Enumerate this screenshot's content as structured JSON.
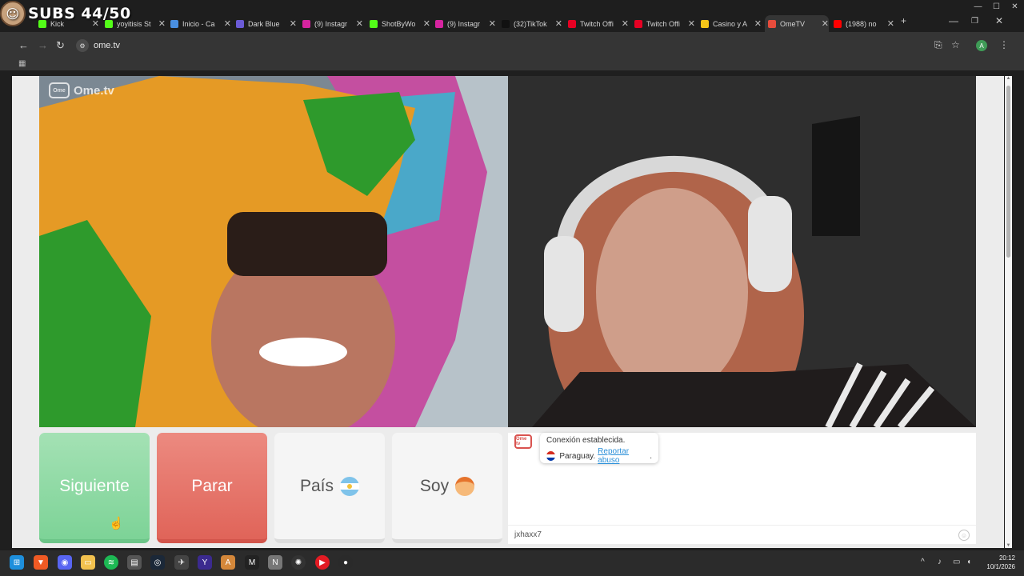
{
  "overlay": {
    "subs_text": "SUBS 44/50"
  },
  "browser": {
    "tabs": [
      {
        "title": "Kick",
        "icon": "kick-icon",
        "color": "#53fc18"
      },
      {
        "title": "yoyitisis St",
        "icon": "kick-icon",
        "color": "#53fc18"
      },
      {
        "title": "Inicio - Ca",
        "icon": "globe-icon",
        "color": "#4a90e2"
      },
      {
        "title": "Dark Blue",
        "icon": "bookmark-icon",
        "color": "#6b5bd6"
      },
      {
        "title": "(9) Instagr",
        "icon": "instagram-icon",
        "color": "#d6249f"
      },
      {
        "title": "ShotByWo",
        "icon": "kick-icon",
        "color": "#53fc18"
      },
      {
        "title": "(9) Instagr",
        "icon": "instagram-icon",
        "color": "#d6249f"
      },
      {
        "title": "(32)TikTok",
        "icon": "tiktok-icon",
        "color": "#111111"
      },
      {
        "title": "Twitch Offi",
        "icon": "pinterest-icon",
        "color": "#e60023"
      },
      {
        "title": "Twitch Offi",
        "icon": "pinterest-icon",
        "color": "#e60023"
      },
      {
        "title": "Casino y A",
        "icon": "casino-icon",
        "color": "#f5c518"
      },
      {
        "title": "OmeTV",
        "icon": "ometv-icon",
        "color": "#e74c3c",
        "active": true
      },
      {
        "title": "(1988) no",
        "icon": "youtube-icon",
        "color": "#ff0000"
      }
    ],
    "url": "ome.tv",
    "profile_initial": "A"
  },
  "app": {
    "logo_text": "Ome.tv",
    "logo_small": "Ome tv",
    "buttons": {
      "next": "Siguiente",
      "stop": "Parar",
      "country": "País",
      "gender": "Soy"
    },
    "chat": {
      "status": "Conexión establecida.",
      "country": "Paraguay.",
      "report_link": "Reportar abuso",
      "report_suffix": ".",
      "input_value": "jxhaxx7"
    }
  },
  "taskbar": {
    "time": "20:12",
    "date": "10/1/2026"
  },
  "colors": {
    "next_button": "#8fdaa4",
    "stop_button": "#e57368",
    "link": "#2a8fd8"
  }
}
